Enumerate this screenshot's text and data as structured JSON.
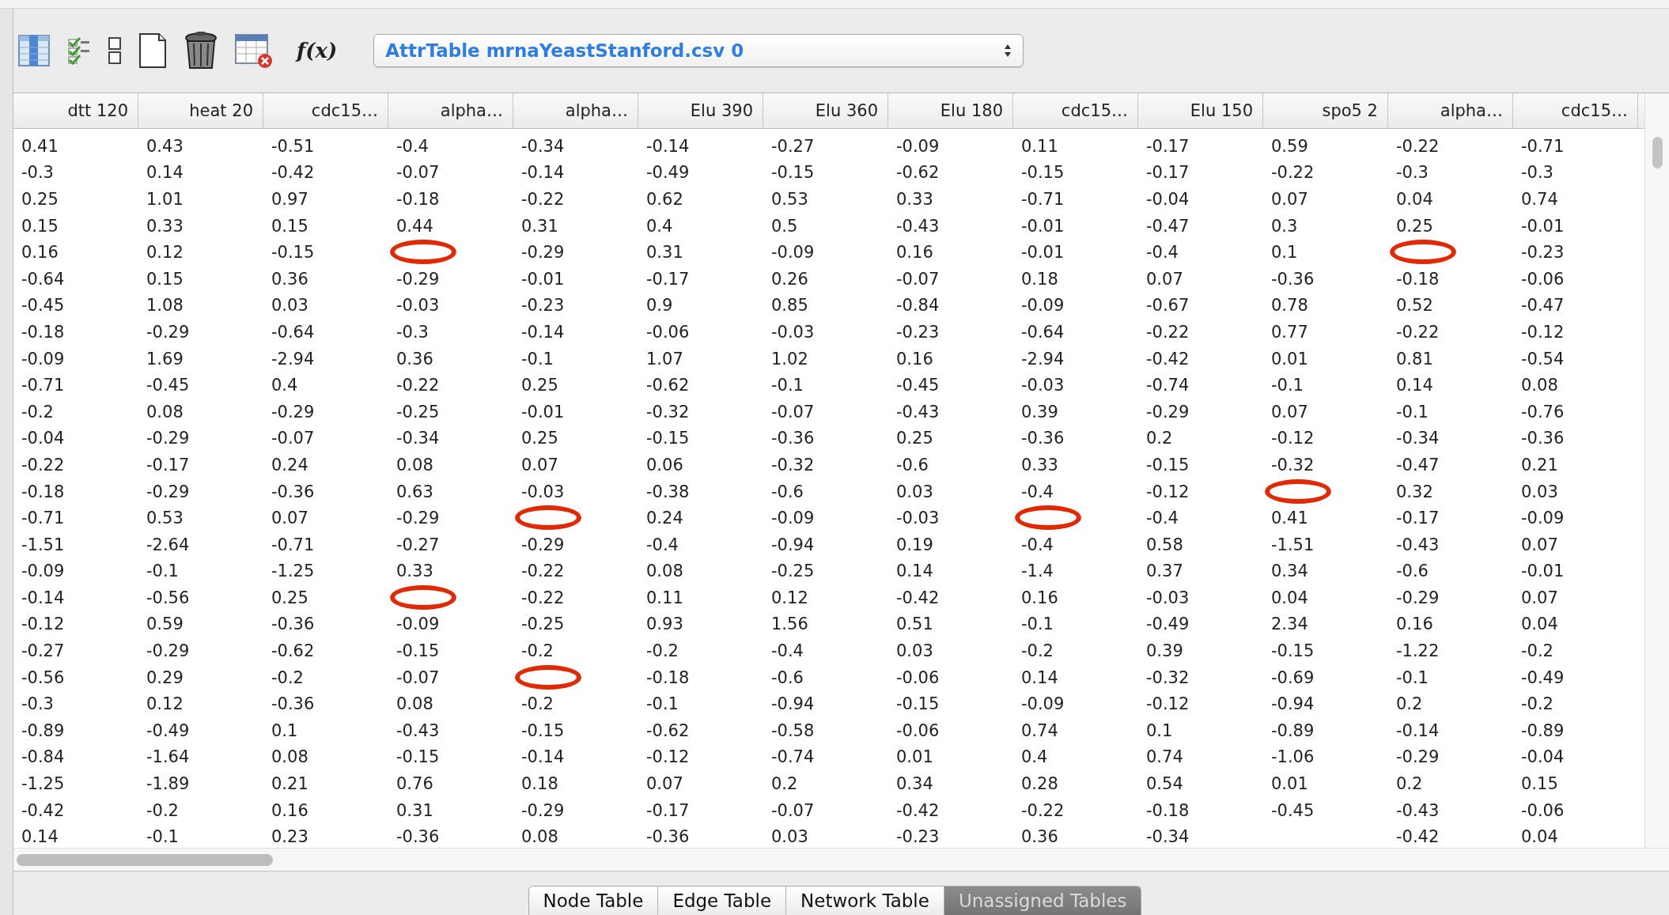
{
  "toolbar": {
    "formula_button": "f(x)",
    "table_selector": {
      "value": "AttrTable mrnaYeastStanford.csv 0"
    }
  },
  "table": {
    "columns": [
      "dtt 120",
      "heat 20",
      "cdc15…",
      "alpha…",
      "alpha…",
      "Elu 390",
      "Elu 360",
      "Elu 180",
      "cdc15…",
      "Elu 150",
      "spo5 2",
      "alpha…",
      "cdc15…"
    ],
    "rows": [
      [
        "0.41",
        "0.43",
        "-0.51",
        "-0.4",
        "-0.34",
        "-0.14",
        "-0.27",
        "-0.09",
        "0.11",
        "-0.17",
        "0.59",
        "-0.22",
        "-0.71"
      ],
      [
        "-0.3",
        "0.14",
        "-0.42",
        "-0.07",
        "-0.14",
        "-0.49",
        "-0.15",
        "-0.62",
        "-0.15",
        "-0.17",
        "-0.22",
        "-0.3",
        "-0.3"
      ],
      [
        "0.25",
        "1.01",
        "0.97",
        "-0.18",
        "-0.22",
        "0.62",
        "0.53",
        "0.33",
        "-0.71",
        "-0.04",
        "0.07",
        "0.04",
        "0.74"
      ],
      [
        "0.15",
        "0.33",
        "0.15",
        "0.44",
        "0.31",
        "0.4",
        "0.5",
        "-0.43",
        "-0.01",
        "-0.47",
        "0.3",
        "0.25",
        "-0.01"
      ],
      [
        "0.16",
        "0.12",
        "-0.15",
        {
          "circled": true
        },
        "-0.29",
        "0.31",
        "-0.09",
        "0.16",
        "-0.01",
        "-0.4",
        "0.1",
        {
          "circled": true
        },
        "-0.23"
      ],
      [
        "-0.64",
        "0.15",
        "0.36",
        "-0.29",
        "-0.01",
        "-0.17",
        "0.26",
        "-0.07",
        "0.18",
        "0.07",
        "-0.36",
        "-0.18",
        "-0.06"
      ],
      [
        "-0.45",
        "1.08",
        "0.03",
        "-0.03",
        "-0.23",
        "0.9",
        "0.85",
        "-0.84",
        "-0.09",
        "-0.67",
        "0.78",
        "0.52",
        "-0.47"
      ],
      [
        "-0.18",
        "-0.29",
        "-0.64",
        "-0.3",
        "-0.14",
        "-0.06",
        "-0.03",
        "-0.23",
        "-0.64",
        "-0.22",
        "0.77",
        "-0.22",
        "-0.12"
      ],
      [
        "-0.09",
        "1.69",
        "-2.94",
        "0.36",
        "-0.1",
        "1.07",
        "1.02",
        "0.16",
        "-2.94",
        "-0.42",
        "0.01",
        "0.81",
        "-0.54"
      ],
      [
        "-0.71",
        "-0.45",
        "0.4",
        "-0.22",
        "0.25",
        "-0.62",
        "-0.1",
        "-0.45",
        "-0.03",
        "-0.74",
        "-0.1",
        "0.14",
        "0.08"
      ],
      [
        "-0.2",
        "0.08",
        "-0.29",
        "-0.25",
        "-0.01",
        "-0.32",
        "-0.07",
        "-0.43",
        "0.39",
        "-0.29",
        "0.07",
        "-0.1",
        "-0.76"
      ],
      [
        "-0.04",
        "-0.29",
        "-0.07",
        "-0.34",
        "0.25",
        "-0.15",
        "-0.36",
        "0.25",
        "-0.36",
        "0.2",
        "-0.12",
        "-0.34",
        "-0.36"
      ],
      [
        "-0.22",
        "-0.17",
        "0.24",
        "0.08",
        "0.07",
        "0.06",
        "-0.32",
        "-0.6",
        "0.33",
        "-0.15",
        "-0.32",
        "-0.47",
        "0.21"
      ],
      [
        "-0.18",
        "-0.29",
        "-0.36",
        "0.63",
        "-0.03",
        "-0.38",
        "-0.6",
        "0.03",
        "-0.4",
        "-0.12",
        {
          "circled": true
        },
        "0.32",
        "0.03"
      ],
      [
        "-0.71",
        "0.53",
        "0.07",
        "-0.29",
        {
          "circled": true
        },
        "0.24",
        "-0.09",
        "-0.03",
        {
          "circled": true
        },
        "-0.4",
        "0.41",
        "-0.17",
        "-0.09"
      ],
      [
        "-1.51",
        "-2.64",
        "-0.71",
        "-0.27",
        "-0.29",
        "-0.4",
        "-0.94",
        "0.19",
        "-0.4",
        "0.58",
        "-1.51",
        "-0.43",
        "0.07"
      ],
      [
        "-0.09",
        "-0.1",
        "-1.25",
        "0.33",
        "-0.22",
        "0.08",
        "-0.25",
        "0.14",
        "-1.4",
        "0.37",
        "0.34",
        "-0.6",
        "-0.01"
      ],
      [
        "-0.14",
        "-0.56",
        "0.25",
        {
          "circled": true
        },
        "-0.22",
        "0.11",
        "0.12",
        "-0.42",
        "0.16",
        "-0.03",
        "0.04",
        "-0.29",
        "0.07"
      ],
      [
        "-0.12",
        "0.59",
        "-0.36",
        "-0.09",
        "-0.25",
        "0.93",
        "1.56",
        "0.51",
        "-0.1",
        "-0.49",
        "2.34",
        "0.16",
        "0.04"
      ],
      [
        "-0.27",
        "-0.29",
        "-0.62",
        "-0.15",
        "-0.2",
        "-0.2",
        "-0.4",
        "0.03",
        "-0.2",
        "0.39",
        "-0.15",
        "-1.22",
        "-0.2"
      ],
      [
        "-0.56",
        "0.29",
        "-0.2",
        "-0.07",
        {
          "circled": true
        },
        "-0.18",
        "-0.6",
        "-0.06",
        "0.14",
        "-0.32",
        "-0.69",
        "-0.1",
        "-0.49"
      ],
      [
        "-0.3",
        "0.12",
        "-0.36",
        "0.08",
        "-0.2",
        "-0.1",
        "-0.94",
        "-0.15",
        "-0.09",
        "-0.12",
        "-0.94",
        "0.2",
        "-0.2"
      ],
      [
        "-0.89",
        "-0.49",
        "0.1",
        "-0.43",
        "-0.15",
        "-0.62",
        "-0.58",
        "-0.06",
        "0.74",
        "0.1",
        "-0.89",
        "-0.14",
        "-0.89"
      ],
      [
        "-0.84",
        "-1.64",
        "0.08",
        "-0.15",
        "-0.14",
        "-0.12",
        "-0.74",
        "0.01",
        "0.4",
        "0.74",
        "-1.06",
        "-0.29",
        "-0.04"
      ],
      [
        "-1.25",
        "-1.89",
        "0.21",
        "0.76",
        "0.18",
        "0.07",
        "0.2",
        "0.34",
        "0.28",
        "0.54",
        "0.01",
        "0.2",
        "0.15"
      ],
      [
        "-0.42",
        "-0.2",
        "0.16",
        "0.31",
        "-0.29",
        "-0.17",
        "-0.07",
        "-0.42",
        "-0.22",
        "-0.18",
        "-0.45",
        "-0.43",
        "-0.06"
      ],
      [
        "0.14",
        "-0.1",
        "0.23",
        "-0.36",
        "0.08",
        "-0.36",
        "0.03",
        "-0.23",
        "0.36",
        "-0.34",
        null,
        "-0.42",
        "0.04"
      ]
    ]
  },
  "tabs": [
    {
      "label": "Node Table",
      "selected": false
    },
    {
      "label": "Edge Table",
      "selected": false
    },
    {
      "label": "Network Table",
      "selected": false
    },
    {
      "label": "Unassigned Tables",
      "selected": true
    }
  ]
}
